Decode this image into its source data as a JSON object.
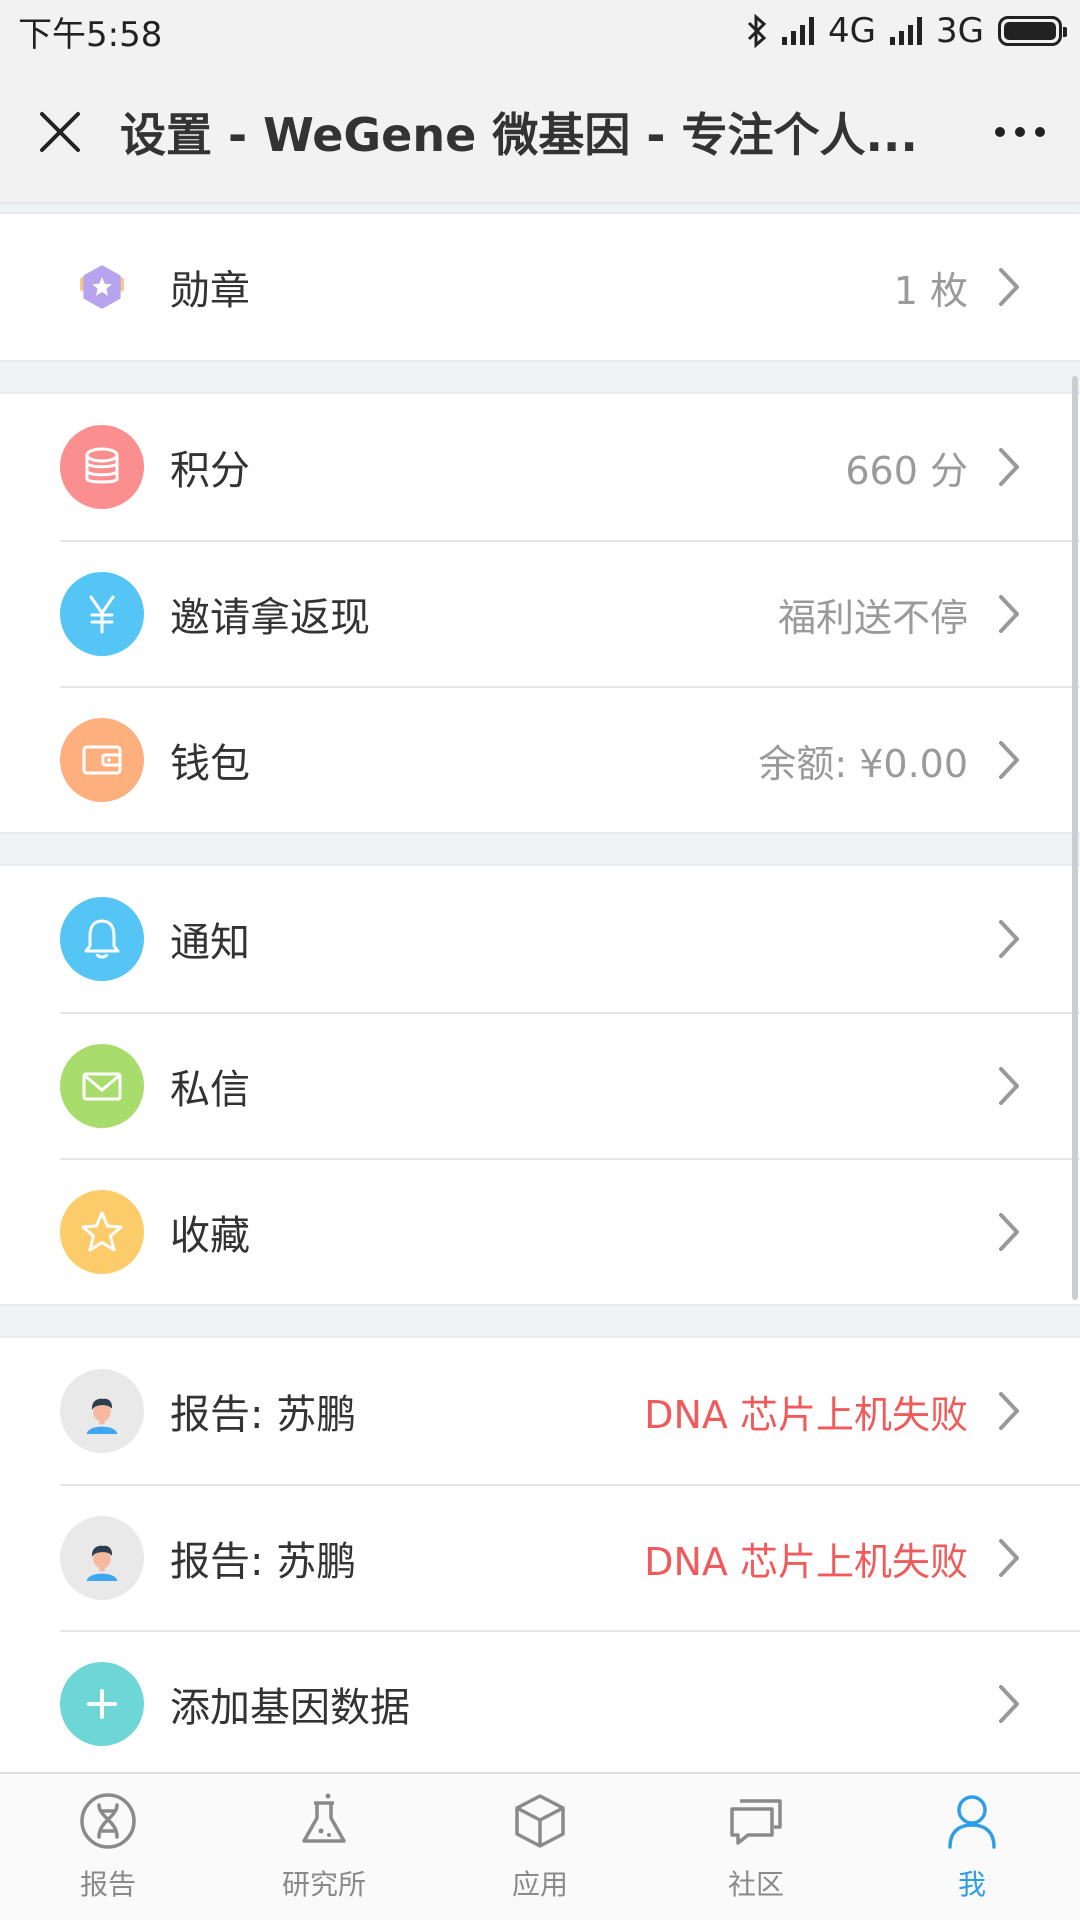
{
  "status_bar": {
    "time": "下午5:58",
    "network1": "4G",
    "network2": "3G"
  },
  "title_bar": {
    "title": "设置 - WeGene 微基因 - 专注个人..."
  },
  "groups": {
    "medal": {
      "label": "勋章",
      "value": "1 枚",
      "icon": "medal-icon",
      "color": "#b9a6f0"
    },
    "points": {
      "label": "积分",
      "value": "660 分",
      "icon": "database-icon",
      "color": "#fb8f8f"
    },
    "invite": {
      "label": "邀请拿返现",
      "value": "福利送不停",
      "icon": "yen-icon",
      "color": "#55c5f5"
    },
    "wallet": {
      "label": "钱包",
      "value": "余额: ¥0.00",
      "icon": "wallet-icon",
      "color": "#fdb07e"
    },
    "notify": {
      "label": "通知",
      "icon": "bell-icon",
      "color": "#55c5f5"
    },
    "message": {
      "label": "私信",
      "icon": "mail-icon",
      "color": "#a8dd6e"
    },
    "favorite": {
      "label": "收藏",
      "icon": "star-icon",
      "color": "#fdcc6a"
    },
    "report1": {
      "label": "报告: 苏鹏",
      "value": "DNA 芯片上机失败",
      "icon": "avatar-icon"
    },
    "report2": {
      "label": "报告: 苏鹏",
      "value": "DNA 芯片上机失败",
      "icon": "avatar-icon"
    },
    "add_data": {
      "label": "添加基因数据",
      "icon": "plus-icon",
      "color": "#6fd6d6"
    }
  },
  "bottom_nav": [
    {
      "label": "报告",
      "icon": "dna-icon"
    },
    {
      "label": "研究所",
      "icon": "flask-icon"
    },
    {
      "label": "应用",
      "icon": "cube-icon"
    },
    {
      "label": "社区",
      "icon": "chat-icon"
    },
    {
      "label": "我",
      "icon": "person-icon",
      "active": true
    }
  ],
  "colors": {
    "accent": "#2f9ee8",
    "error": "#f05a5a"
  }
}
